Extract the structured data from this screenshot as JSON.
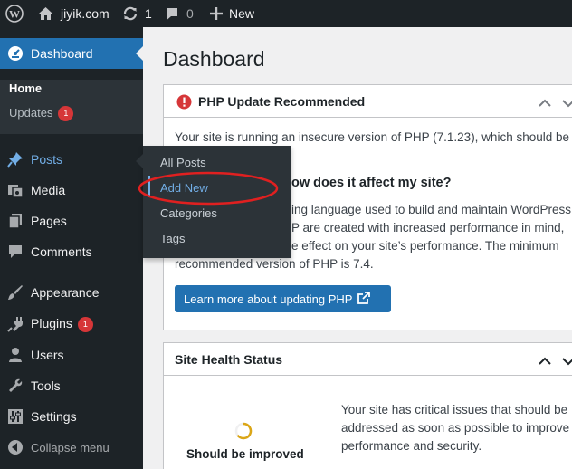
{
  "adminbar": {
    "site_name": "jiyik.com",
    "updates_count": "1",
    "comments_count": "0",
    "new_label": "New"
  },
  "sidebar": {
    "dashboard": "Dashboard",
    "home": "Home",
    "updates": "Updates",
    "updates_badge": "1",
    "posts": "Posts",
    "media": "Media",
    "pages": "Pages",
    "comments": "Comments",
    "appearance": "Appearance",
    "plugins": "Plugins",
    "plugins_badge": "1",
    "users": "Users",
    "tools": "Tools",
    "settings": "Settings",
    "collapse": "Collapse menu"
  },
  "flyout": {
    "all_posts": "All Posts",
    "add_new": "Add New",
    "categories": "Categories",
    "tags": "Tags"
  },
  "main": {
    "title": "Dashboard",
    "php_box": {
      "title": "PHP Update Recommended",
      "line1": "Your site is running an insecure version of PHP (7.1.23), which should be",
      "heading_partial": "ow does it affect my site?",
      "line2": "ing language used to build and maintain WordPress",
      "line3": "P are created with increased performance in mind,",
      "line4": "e effect on your site’s performance. The minimum",
      "line5": "recommended version of PHP is 7.4.",
      "button": "Learn more about updating PHP"
    },
    "health_box": {
      "title": "Site Health Status",
      "status": "Should be improved",
      "line1": "Your site has critical issues that should be",
      "line2": "addressed as soon as possible to improve",
      "line3": "performance and security."
    }
  },
  "colors": {
    "accent": "#2271b1",
    "adminbar": "#1d2327",
    "badge": "#d63638",
    "annotation": "#e02020"
  }
}
